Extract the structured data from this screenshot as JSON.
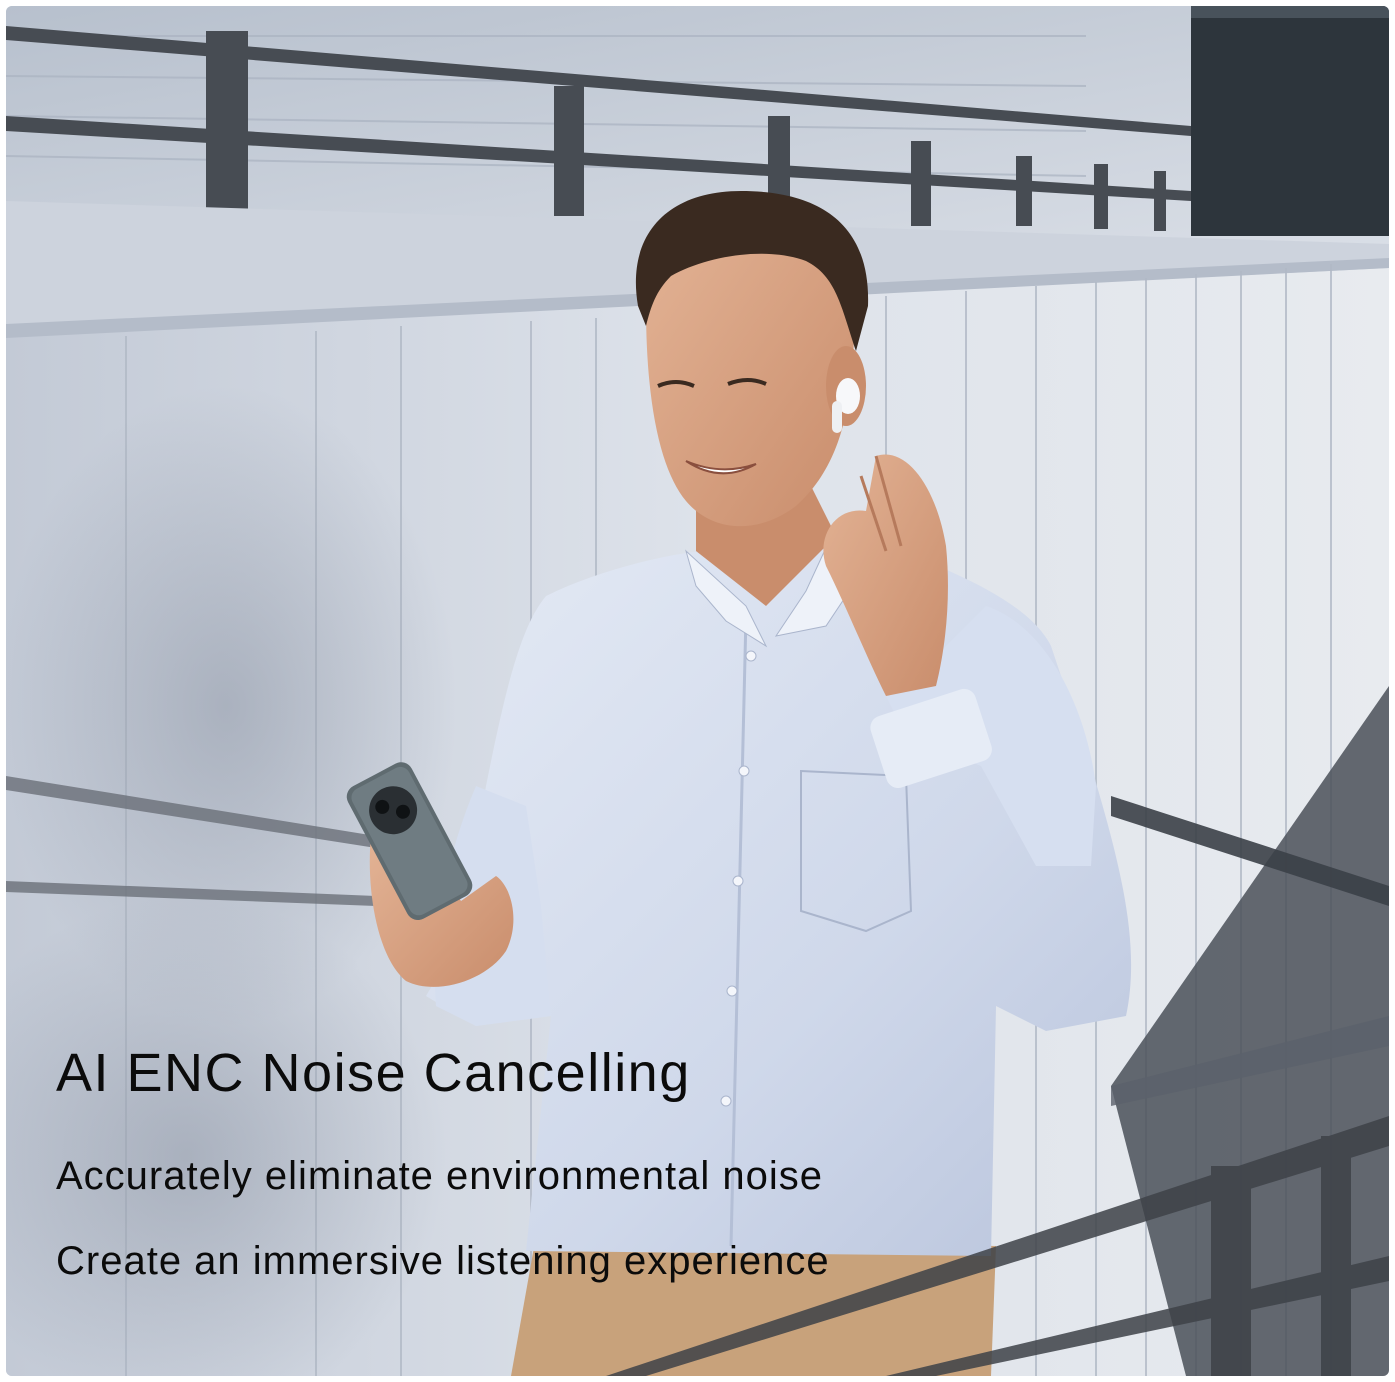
{
  "banner": {
    "headline": "AI ENC Noise Cancelling",
    "lines": [
      "Accurately eliminate environmental noise",
      "Create an immersive listening experience"
    ]
  },
  "photo": {
    "subject": "man-with-earbud-and-phone",
    "palette": {
      "wall": "#c9cfd8",
      "wall_shadow": "#a9b1bf",
      "railing": "#3e4248",
      "shirt": "#d9e1f0",
      "skin": "#d9a586",
      "hair": "#3a2a20",
      "trousers": "#c8a27b",
      "phone": "#5f6b70",
      "text": "#0b0b0b"
    }
  }
}
